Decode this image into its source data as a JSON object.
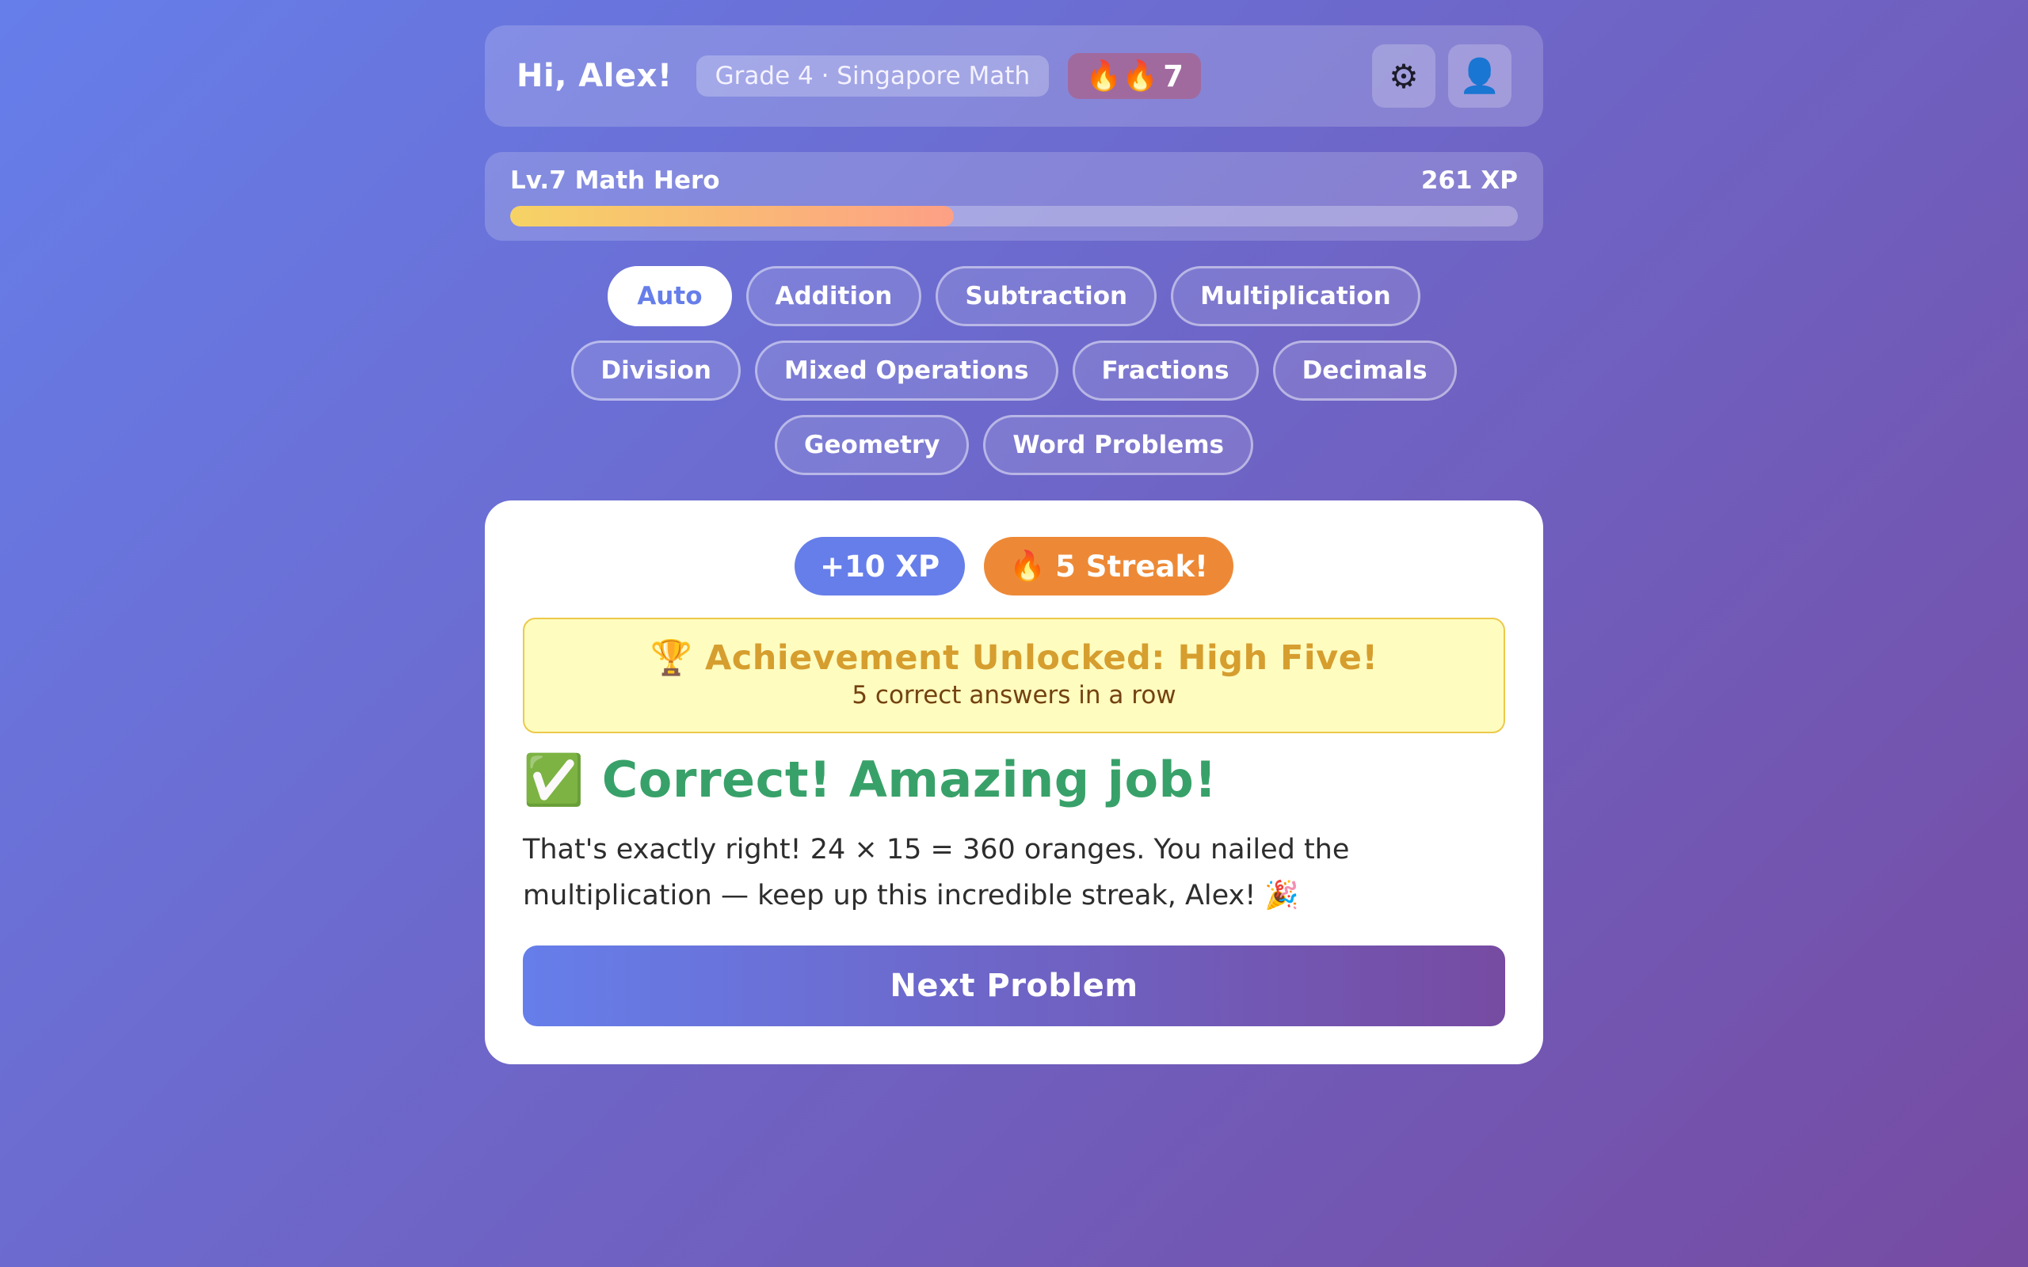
{
  "header": {
    "greeting": "Hi, Alex!",
    "grade": "Grade 4 · Singapore Math",
    "streak_icon": "fire-icon",
    "streak_glyph": "🔥🔥",
    "streak_count": "7",
    "settings_icon": "gear-icon",
    "settings_glyph": "⚙",
    "profile_icon": "user-icon",
    "profile_glyph": "👤"
  },
  "level": {
    "label": "Lv.7 Math Hero",
    "xp_label": "261 XP",
    "progress_fraction": 0.44
  },
  "topics": {
    "items": [
      "Auto",
      "Addition",
      "Subtraction",
      "Multiplication",
      "Division",
      "Mixed Operations",
      "Fractions",
      "Decimals",
      "Geometry",
      "Word Problems"
    ],
    "active": "Auto"
  },
  "result": {
    "xp_badge": "+10 XP",
    "streak_badge_icon": "fire-icon",
    "streak_badge_glyph": "🔥",
    "streak_badge": "5 Streak!",
    "achievement_icon": "trophy-icon",
    "achievement_glyph": "🏆",
    "achievement_title": "Achievement Unlocked: High Five!",
    "achievement_sub": "5 correct answers in a row",
    "title_icon": "check-icon",
    "title_glyph": "✅",
    "title": "Correct! Amazing job!",
    "explanation": "That's exactly right! 24 × 15 = 360 oranges. You nailed the multiplication — keep up this incredible streak, Alex! 🎉",
    "next_button": "Next Problem"
  },
  "colors": {
    "bg_start": "#667eea",
    "bg_end": "#764ba2",
    "success": "#38a169",
    "streak": "#ed8936",
    "achievement_bg": "#fefcbf",
    "achievement_text": "#d69e2e"
  }
}
